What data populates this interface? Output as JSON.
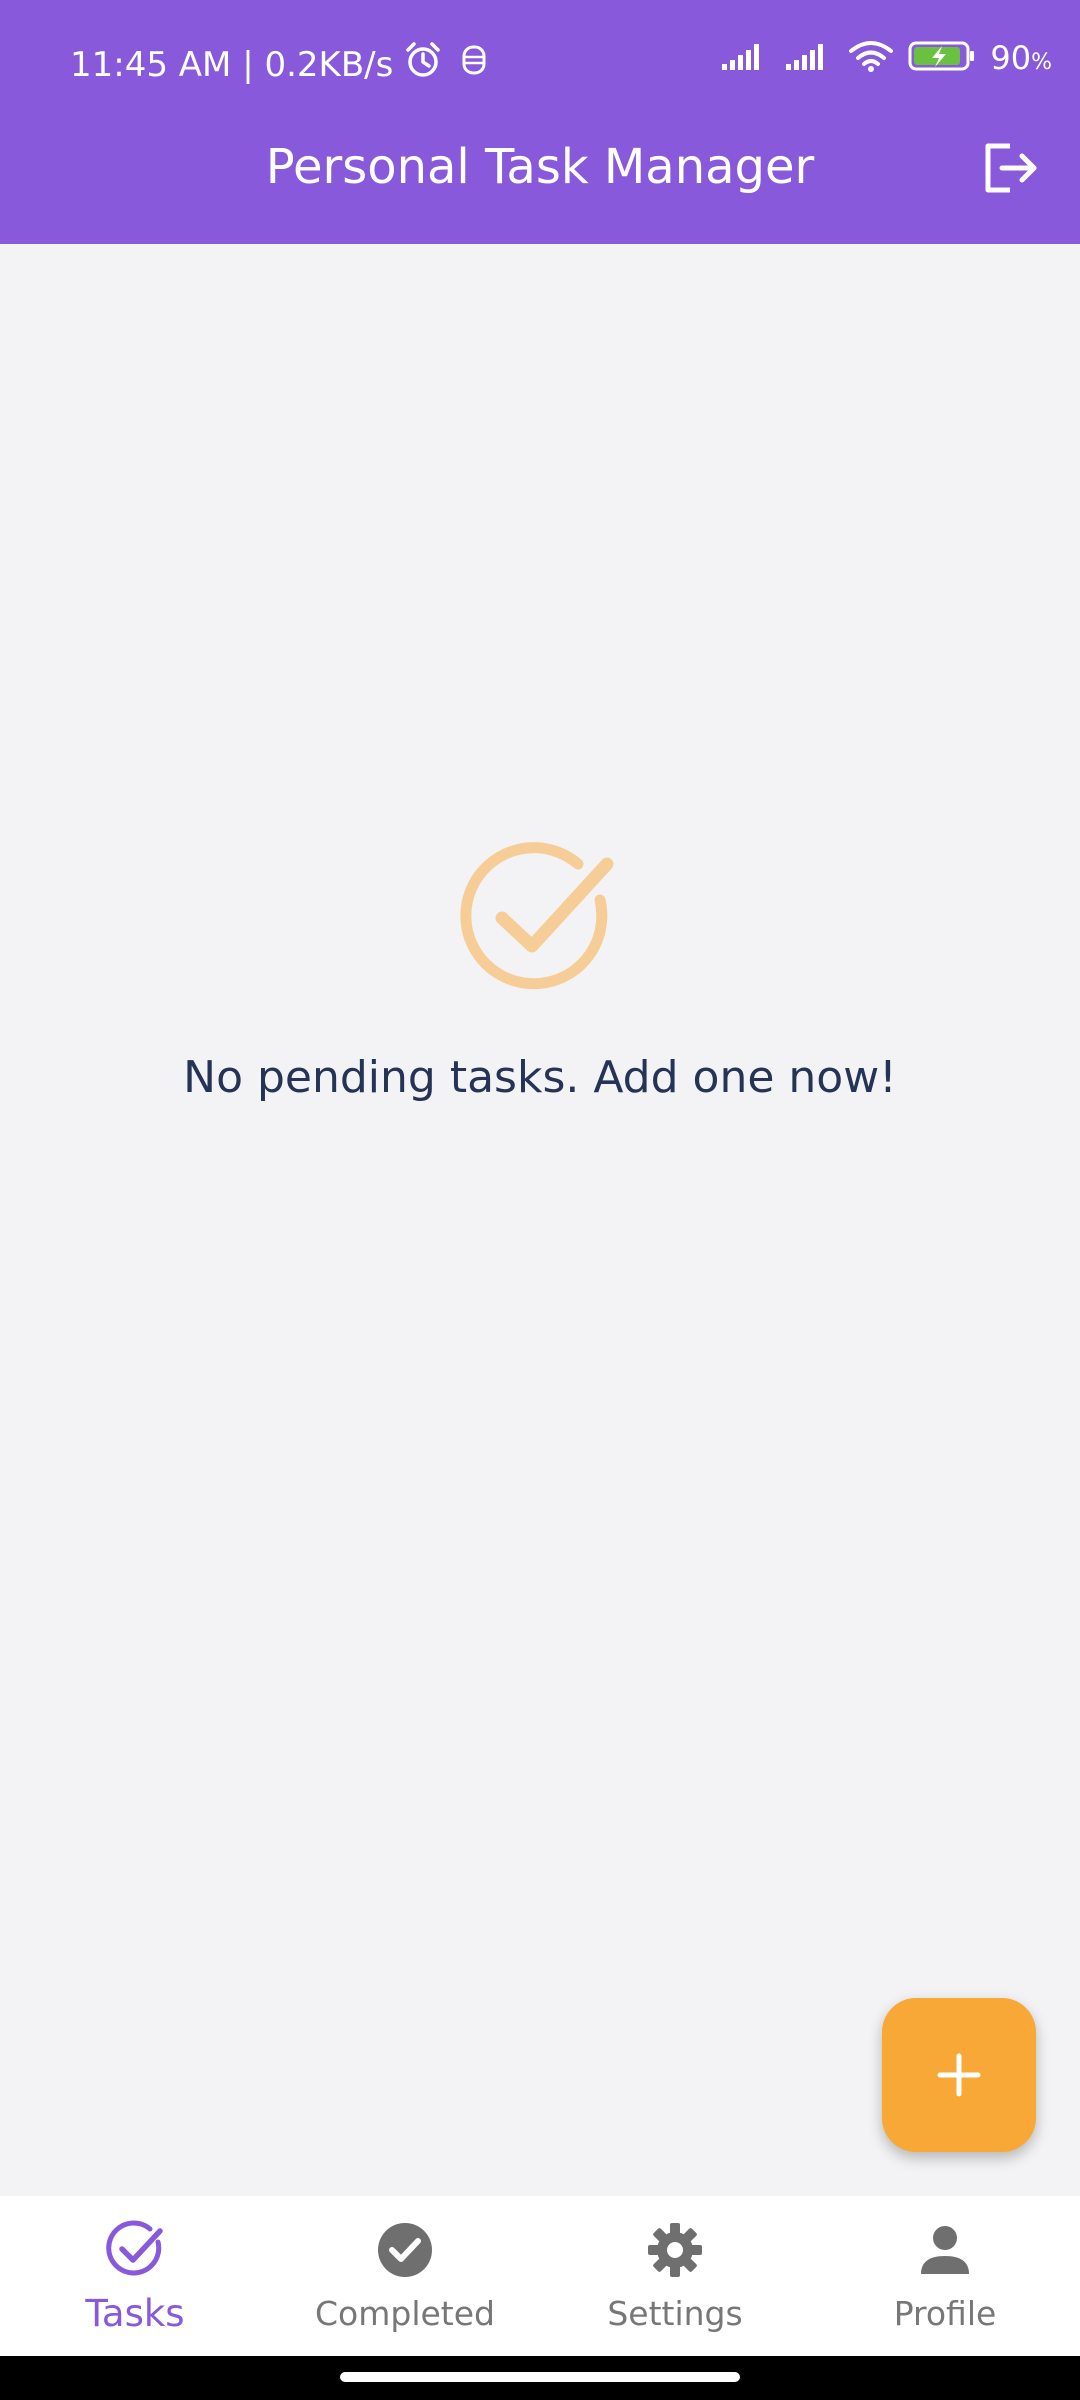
{
  "status_bar": {
    "time_and_speed": "11:45 AM | 0.2KB/s",
    "battery_percent": "90",
    "battery_unit": "%"
  },
  "app_bar": {
    "title": "Personal Task Manager",
    "logout_icon": "logout-icon"
  },
  "empty_state": {
    "message": "No pending tasks. Add one now!",
    "icon": "check-circle-icon"
  },
  "fab": {
    "icon": "plus-icon"
  },
  "bottom_nav": {
    "items": [
      {
        "label": "Tasks",
        "icon": "check-circle-outline-icon",
        "active": true
      },
      {
        "label": "Completed",
        "icon": "check-circle-filled-icon",
        "active": false
      },
      {
        "label": "Settings",
        "icon": "gear-icon",
        "active": false
      },
      {
        "label": "Profile",
        "icon": "person-icon",
        "active": false
      }
    ]
  },
  "colors": {
    "primary": "#8859da",
    "accent": "#f8a836",
    "empty_icon": "#f6cd96",
    "text_dark": "#253356",
    "nav_inactive": "#777777",
    "background": "#f3f3f5"
  }
}
